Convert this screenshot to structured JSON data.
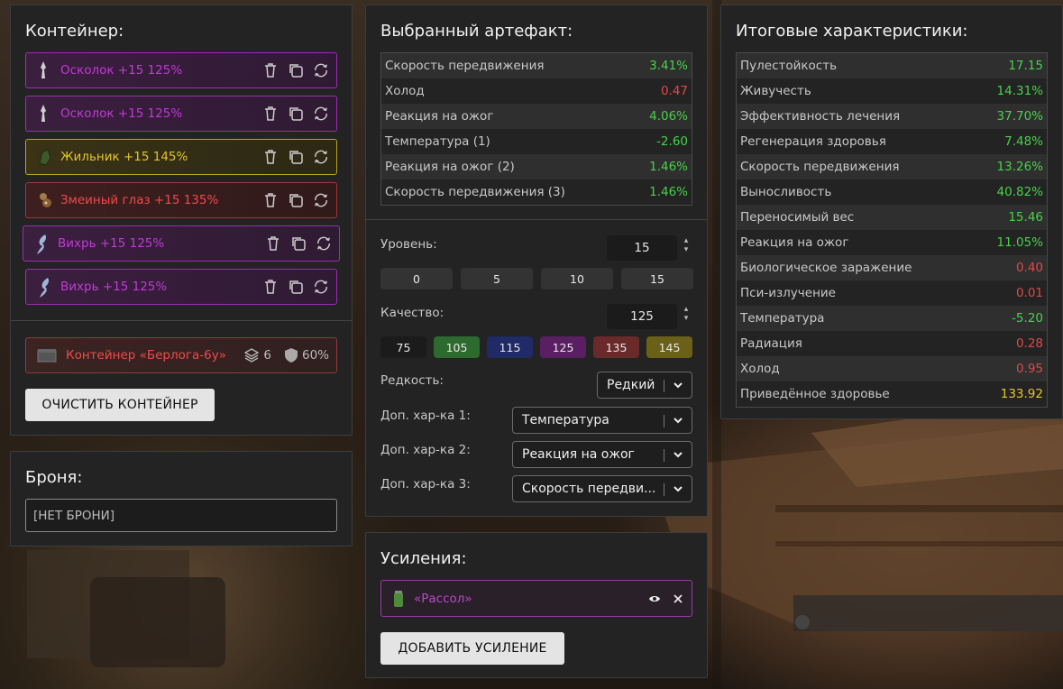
{
  "container": {
    "title": "Контейнер:",
    "items": [
      {
        "label": "Осколок +15 125%",
        "style": "purple",
        "icon": "shard-icon"
      },
      {
        "label": "Осколок +15 125%",
        "style": "purple",
        "icon": "shard-icon"
      },
      {
        "label": "Жильник +15 145%",
        "style": "yellow",
        "icon": "vein-icon"
      },
      {
        "label": "Змеиный глаз +15 135%",
        "style": "red",
        "icon": "snake-eye-icon"
      },
      {
        "label": "Вихрь +15 125%",
        "style": "purple",
        "icon": "whirl-icon"
      },
      {
        "label": "Вихрь +15 125%",
        "style": "purple",
        "icon": "whirl-icon"
      }
    ],
    "container_item": {
      "label": "Контейнер «Берлога-6у»",
      "slots": "6",
      "protection": "60%"
    },
    "clear_button": "ОЧИСТИТЬ КОНТЕЙНЕР"
  },
  "armor": {
    "title": "Броня:",
    "value": "[НЕТ БРОНИ]"
  },
  "artifact": {
    "title": "Выбранный артефакт:",
    "stats": [
      {
        "name": "Скорость передвижения",
        "value": "3.41%",
        "color": "g"
      },
      {
        "name": "Холод",
        "value": "0.47",
        "color": "r"
      },
      {
        "name": "Реакция на ожог",
        "value": "4.06%",
        "color": "g"
      },
      {
        "name": "Температура (1)",
        "value": "-2.60",
        "color": "g"
      },
      {
        "name": "Реакция на ожог (2)",
        "value": "1.46%",
        "color": "g"
      },
      {
        "name": "Скорость передвижения (3)",
        "value": "1.46%",
        "color": "g"
      }
    ],
    "level_label": "Уровень:",
    "level_value": "15",
    "level_presets": [
      "0",
      "5",
      "10",
      "15"
    ],
    "quality_label": "Качество:",
    "quality_value": "125",
    "quality_presets": [
      {
        "label": "75",
        "color": "#1b1b1b"
      },
      {
        "label": "105",
        "color": "#2c6a2e"
      },
      {
        "label": "115",
        "color": "#1f2a66"
      },
      {
        "label": "125",
        "color": "#5a1f62"
      },
      {
        "label": "135",
        "color": "#6a2a2a"
      },
      {
        "label": "145",
        "color": "#6b6018"
      }
    ],
    "rarity_label": "Редкость:",
    "rarity_value": "Редкий",
    "extra1_label": "Доп. хар-ка 1:",
    "extra1_value": "Температура",
    "extra2_label": "Доп. хар-ка 2:",
    "extra2_value": "Реакция на ожог",
    "extra3_label": "Доп. хар-ка 3:",
    "extra3_value": "Скорость передви..."
  },
  "boosts": {
    "title": "Усиления:",
    "items": [
      {
        "label": "«Рассол»"
      }
    ],
    "add_button": "ДОБАВИТЬ УСИЛЕНИЕ"
  },
  "totals": {
    "title": "Итоговые характеристики:",
    "stats": [
      {
        "name": "Пулестойкость",
        "value": "17.15",
        "color": "g"
      },
      {
        "name": "Живучесть",
        "value": "14.31%",
        "color": "g"
      },
      {
        "name": "Эффективность лечения",
        "value": "37.70%",
        "color": "g"
      },
      {
        "name": "Регенерация здоровья",
        "value": "7.48%",
        "color": "g"
      },
      {
        "name": "Скорость передвижения",
        "value": "13.26%",
        "color": "g"
      },
      {
        "name": "Выносливость",
        "value": "40.82%",
        "color": "g"
      },
      {
        "name": "Переносимый вес",
        "value": "15.46",
        "color": "g"
      },
      {
        "name": "Реакция на ожог",
        "value": "11.05%",
        "color": "g"
      },
      {
        "name": "Биологическое заражение",
        "value": "0.40",
        "color": "r"
      },
      {
        "name": "Пси-излучение",
        "value": "0.01",
        "color": "r"
      },
      {
        "name": "Температура",
        "value": "-5.20",
        "color": "g"
      },
      {
        "name": "Радиация",
        "value": "0.28",
        "color": "r"
      },
      {
        "name": "Холод",
        "value": "0.95",
        "color": "r"
      },
      {
        "name": "Приведённое здоровье",
        "value": "133.92",
        "color": "y"
      }
    ]
  }
}
